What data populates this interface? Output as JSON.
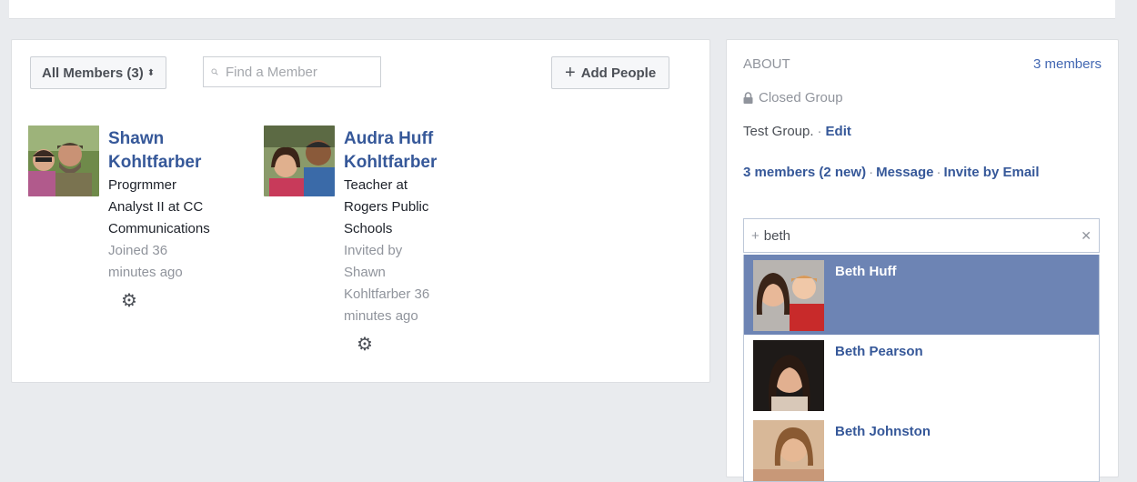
{
  "members_section": {
    "filter_label": "All Members (3)",
    "filter_chevron": "⬍",
    "search_placeholder": "Find a Member",
    "add_people_label": "Add People",
    "members": [
      {
        "name_line1": "Shawn",
        "name_line2": "Kohltfarber",
        "job_lines": [
          "Progrmmer",
          "Analyst II at CC",
          "Communications"
        ],
        "meta_lines": [
          "Joined 36",
          "minutes ago"
        ]
      },
      {
        "name_line1": "Audra Huff",
        "name_line2": "Kohltfarber",
        "job_lines": [
          "Teacher at",
          "Rogers Public",
          "Schools"
        ],
        "meta_lines": [
          "Invited by",
          "Shawn",
          "Kohltfarber 36",
          "minutes ago"
        ]
      }
    ]
  },
  "about_section": {
    "title": "ABOUT",
    "member_count": "3 members",
    "privacy": "Closed Group",
    "description": "Test Group.",
    "edit_label": "Edit",
    "members_link": "3 members",
    "new_count": "(2 new)",
    "message_link": "Message",
    "invite_email_link": "Invite by Email",
    "invite_input_value": "beth",
    "suggestions": [
      {
        "name": "Beth Huff"
      },
      {
        "name": "Beth Pearson"
      },
      {
        "name": "Beth Johnston"
      }
    ]
  },
  "colors": {
    "link": "#365899",
    "selected_row": "#6d84b4",
    "page_bg": "#e9ebee"
  }
}
